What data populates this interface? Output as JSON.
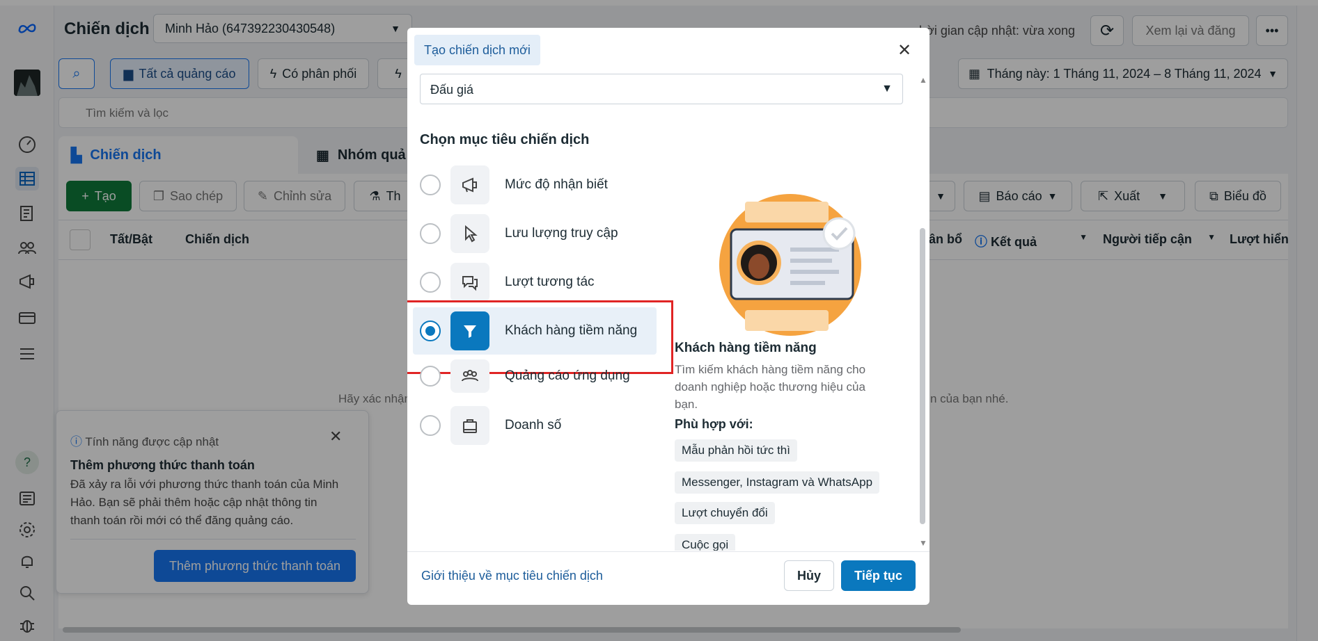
{
  "sidebar": {
    "logo": "meta-logo",
    "icons": [
      "dashboard-icon",
      "campaigns-icon",
      "catalog-icon",
      "audience-icon",
      "ads-icon",
      "billing-icon",
      "menu-icon",
      "help-icon",
      "news-icon",
      "settings-icon",
      "notifications-icon",
      "search-icon",
      "bug-icon"
    ]
  },
  "header": {
    "title": "Chiến dịch",
    "account": "Minh Hảo (647392230430548)",
    "update_time": "hời gian cập nhật: vừa xong",
    "review_button": "Xem lại và đăng",
    "date_range": "Tháng này: 1 Tháng 11, 2024 – 8 Tháng 11, 2024"
  },
  "filters": {
    "all_ads": "Tất cả quảng cáo",
    "delivering": "Có phân phối",
    "search_placeholder": "Tìm kiếm và lọc"
  },
  "tabs": {
    "campaigns": "Chiến dịch",
    "ad_sets": "Nhóm quả"
  },
  "toolbar": {
    "create": "Tạo",
    "copy": "Sao chép",
    "edit": "Chỉnh sửa",
    "test": "Th",
    "report": "Báo cáo",
    "export": "Xuất",
    "chart": "Biểu đồ"
  },
  "table": {
    "col_toggle": "Tất/Bật",
    "col_campaign": "Chiến dịch",
    "col_budget": "ân bổ",
    "col_results": "Kết quả",
    "col_reach": "Người tiếp cận",
    "col_impressions": "Lượt hiển",
    "empty_left": "Hãy xác nhận",
    "empty_right": "n của bạn nhé."
  },
  "notice": {
    "header": "Tính năng được cập nhật",
    "title": "Thêm phương thức thanh toán",
    "body_1": "Đã xảy ra lỗi với phương thức thanh toán của Minh",
    "body_2": "Hảo. Bạn sẽ phải thêm hoặc cập nhật thông tin",
    "body_3": "thanh toán rồi mới có thể đăng quảng cáo.",
    "button": "Thêm phương thức thanh toán"
  },
  "modal": {
    "title": "Tạo chiến dịch mới",
    "buying_type": "Đấu giá",
    "section_title": "Chọn mục tiêu chiến dịch",
    "options": [
      {
        "label": "Mức độ nhận biết",
        "icon": "megaphone-icon"
      },
      {
        "label": "Lưu lượng truy cập",
        "icon": "cursor-icon"
      },
      {
        "label": "Lượt tương tác",
        "icon": "chat-icon"
      },
      {
        "label": "Khách hàng tiềm năng",
        "icon": "filter-icon",
        "selected": true
      },
      {
        "label": "Quảng cáo ứng dụng",
        "icon": "people-icon"
      },
      {
        "label": "Doanh số",
        "icon": "bag-icon"
      }
    ],
    "detail": {
      "title": "Khách hàng tiềm năng",
      "desc_1": "Tìm kiếm khách hàng tiềm năng cho",
      "desc_2": "doanh nghiệp hoặc thương hiệu của",
      "desc_3": "bạn.",
      "fit_label": "Phù hợp với:",
      "tags": [
        "Mẫu phản hồi tức thì",
        "Messenger, Instagram và WhatsApp",
        "Lượt chuyển đổi",
        "Cuộc gọi"
      ]
    },
    "footer": {
      "link": "Giới thiệu về mục tiêu chiến dịch",
      "cancel": "Hủy",
      "continue": "Tiếp tục"
    }
  },
  "colors": {
    "accent": "#0a78be",
    "primary_button": "#1877f2",
    "highlight_border": "#e02424",
    "create_green": "#0f7b3a",
    "illustration_orange": "#f5a340"
  }
}
